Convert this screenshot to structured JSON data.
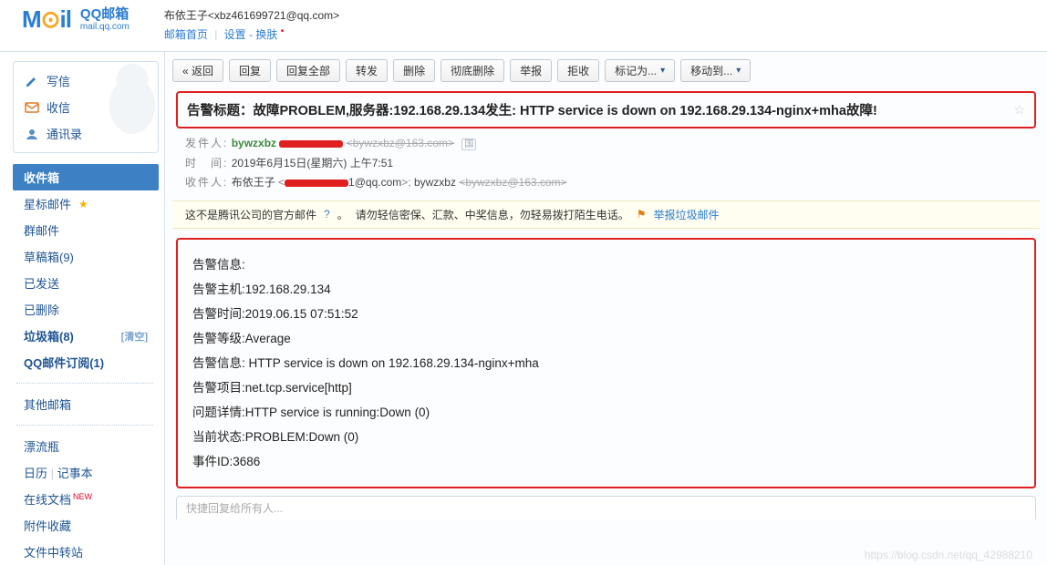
{
  "header": {
    "logo_brand": "QQ邮箱",
    "logo_domain": "mail.qq.com",
    "user_display": "布依王子<xbz461699721@qq.com>",
    "links": {
      "home": "邮箱首页",
      "settings": "设置",
      "skin": "换肤"
    }
  },
  "sidebar": {
    "compose": "写信",
    "receive": "收信",
    "contacts": "通讯录",
    "inbox": "收件箱",
    "starred": "星标邮件",
    "group": "群邮件",
    "drafts": "草稿箱(9)",
    "sent": "已发送",
    "deleted": "已删除",
    "spam": "垃圾箱(8)",
    "spam_clear": "[清空]",
    "subscription": "QQ邮件订阅(1)",
    "other": "其他邮箱",
    "drift": "漂流瓶",
    "calendar": "日历",
    "notes": "记事本",
    "online_docs": "在线文档",
    "attachments": "附件收藏",
    "transfer": "文件中转站"
  },
  "toolbar": {
    "back": "« 返回",
    "reply": "回复",
    "reply_all": "回复全部",
    "forward": "转发",
    "delete": "删除",
    "delete_perm": "彻底删除",
    "report": "举报",
    "reject": "拒收",
    "mark_as": "标记为...",
    "move_to": "移动到..."
  },
  "mail": {
    "subject": "告警标题：故障PROBLEM,服务器:192.168.29.134发生: HTTP service is down on 192.168.29.134-nginx+mha故障!",
    "from_label": "发件人:",
    "from_name": "bywzxbz",
    "from_addr": "<bywzxbz@163.com>",
    "time_label": "时　间:",
    "time_value": "2019年6月15日(星期六) 上午7:51",
    "to_label": "收件人:",
    "to_name": "布依王子",
    "to_addr1": "1@qq.com",
    "to_name2": "bywzxbz",
    "to_addr2": "<bywzxbz@163.com>"
  },
  "notice": {
    "text1": "这不是腾讯公司的官方邮件",
    "text2": "请勿轻信密保、汇款、中奖信息，勿轻易拨打陌生电话。",
    "report_link": "举报垃圾邮件"
  },
  "body": {
    "l1": "告警信息:",
    "l2": "告警主机:192.168.29.134",
    "l3": "告警时间:2019.06.15 07:51:52",
    "l4": "告警等级:Average",
    "l5": "告警信息: HTTP service is down on 192.168.29.134-nginx+mha",
    "l6": "告警项目:net.tcp.service[http]",
    "l7": "问题详情:HTTP service is running:Down (0)",
    "l8": "当前状态:PROBLEM:Down (0)",
    "l9": "事件ID:3686"
  },
  "quick_reply": {
    "placeholder": "快捷回复给所有人..."
  },
  "watermark": "https://blog.csdn.net/qq_42988210"
}
